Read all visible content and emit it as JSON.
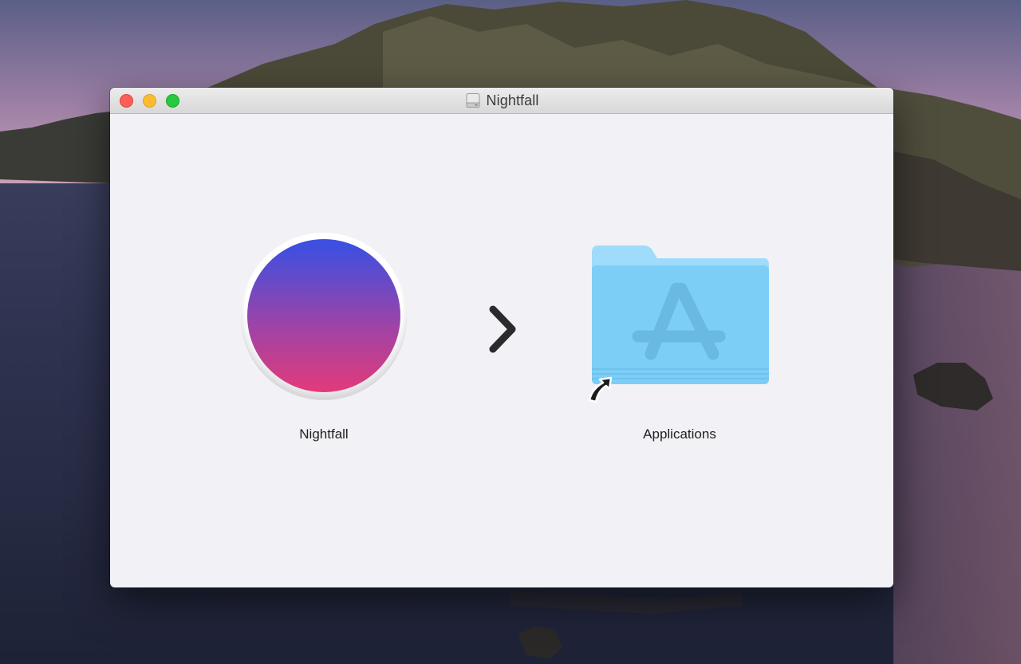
{
  "desktop": {
    "wallpaper": "landscape-wallpaper"
  },
  "window": {
    "title": "Nightfall",
    "title_icon": "disk-icon",
    "controls": [
      "close",
      "minimize",
      "zoom"
    ]
  },
  "items": [
    {
      "label": "Nightfall",
      "icon": "nightfall-app-icon"
    },
    {
      "label": "Applications",
      "icon": "applications-folder-icon"
    }
  ],
  "arrow_icon": "chevron-right-icon",
  "colors": {
    "window_bg": "#f2f1f5",
    "gradient_top": "#3f4fe0",
    "gradient_bottom": "#e33a7a",
    "folder_blue": "#7fd0f6",
    "close": "#fc5f57",
    "minimize": "#fdbc2e",
    "zoom": "#28c840"
  }
}
